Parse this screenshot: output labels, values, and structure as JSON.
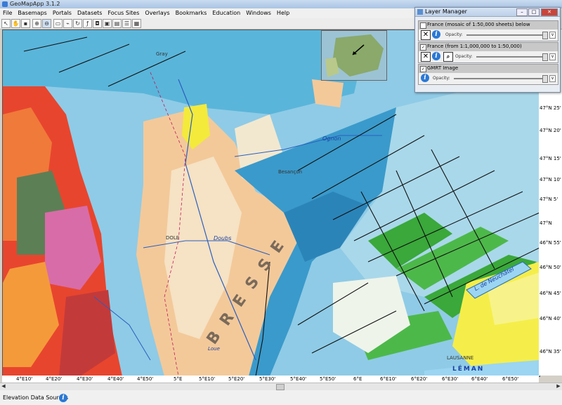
{
  "app": {
    "title": "GeoMapApp 3.1.2"
  },
  "menu": [
    "File",
    "Basemaps",
    "Portals",
    "Datasets",
    "Focus Sites",
    "Overlays",
    "Bookmarks",
    "Education",
    "Windows",
    "Help"
  ],
  "map": {
    "lon_ticks": [
      "4°E10'",
      "4°E20'",
      "4°E30'",
      "4°E40'",
      "4°E50'",
      "5°E",
      "5°E10'",
      "5°E20'",
      "5°E30'",
      "5°E40'",
      "5°E50'",
      "6°E",
      "6°E10'",
      "6°E20'",
      "6°E30'",
      "6°E40'",
      "6°E50'"
    ],
    "lat_ticks": [
      "47°N 25'",
      "47°N 20'",
      "47°N 15'",
      "47°N 10'",
      "47°N 5'",
      "47°N",
      "46°N 55'",
      "46°N 50'",
      "46°N 45'",
      "46°N 40'",
      "46°N 35'"
    ],
    "labels": {
      "bresse": "B R E S S E",
      "doubs": "Doubs",
      "ognon": "Ognon",
      "lac": "L. de Neuchâtel",
      "leman": "LÉMAN",
      "lausanne": "LAUSANNE",
      "dole": "DOLE",
      "gray": "Gray",
      "besancon": "Besançon",
      "loue": "Loue"
    }
  },
  "layer_manager": {
    "title": "Layer Manager",
    "layers": [
      {
        "name": "France (mosaic of 1:50,000 sheets) below",
        "opacity_label": "Opacity:"
      },
      {
        "name": "France (from 1:1,000,000 to 1:50,000)",
        "opacity_label": "Opacity:"
      },
      {
        "name": "GMRT Image",
        "opacity_label": "Opacity:"
      }
    ]
  },
  "status": {
    "elevation_label": "Elevation Data Sources"
  }
}
